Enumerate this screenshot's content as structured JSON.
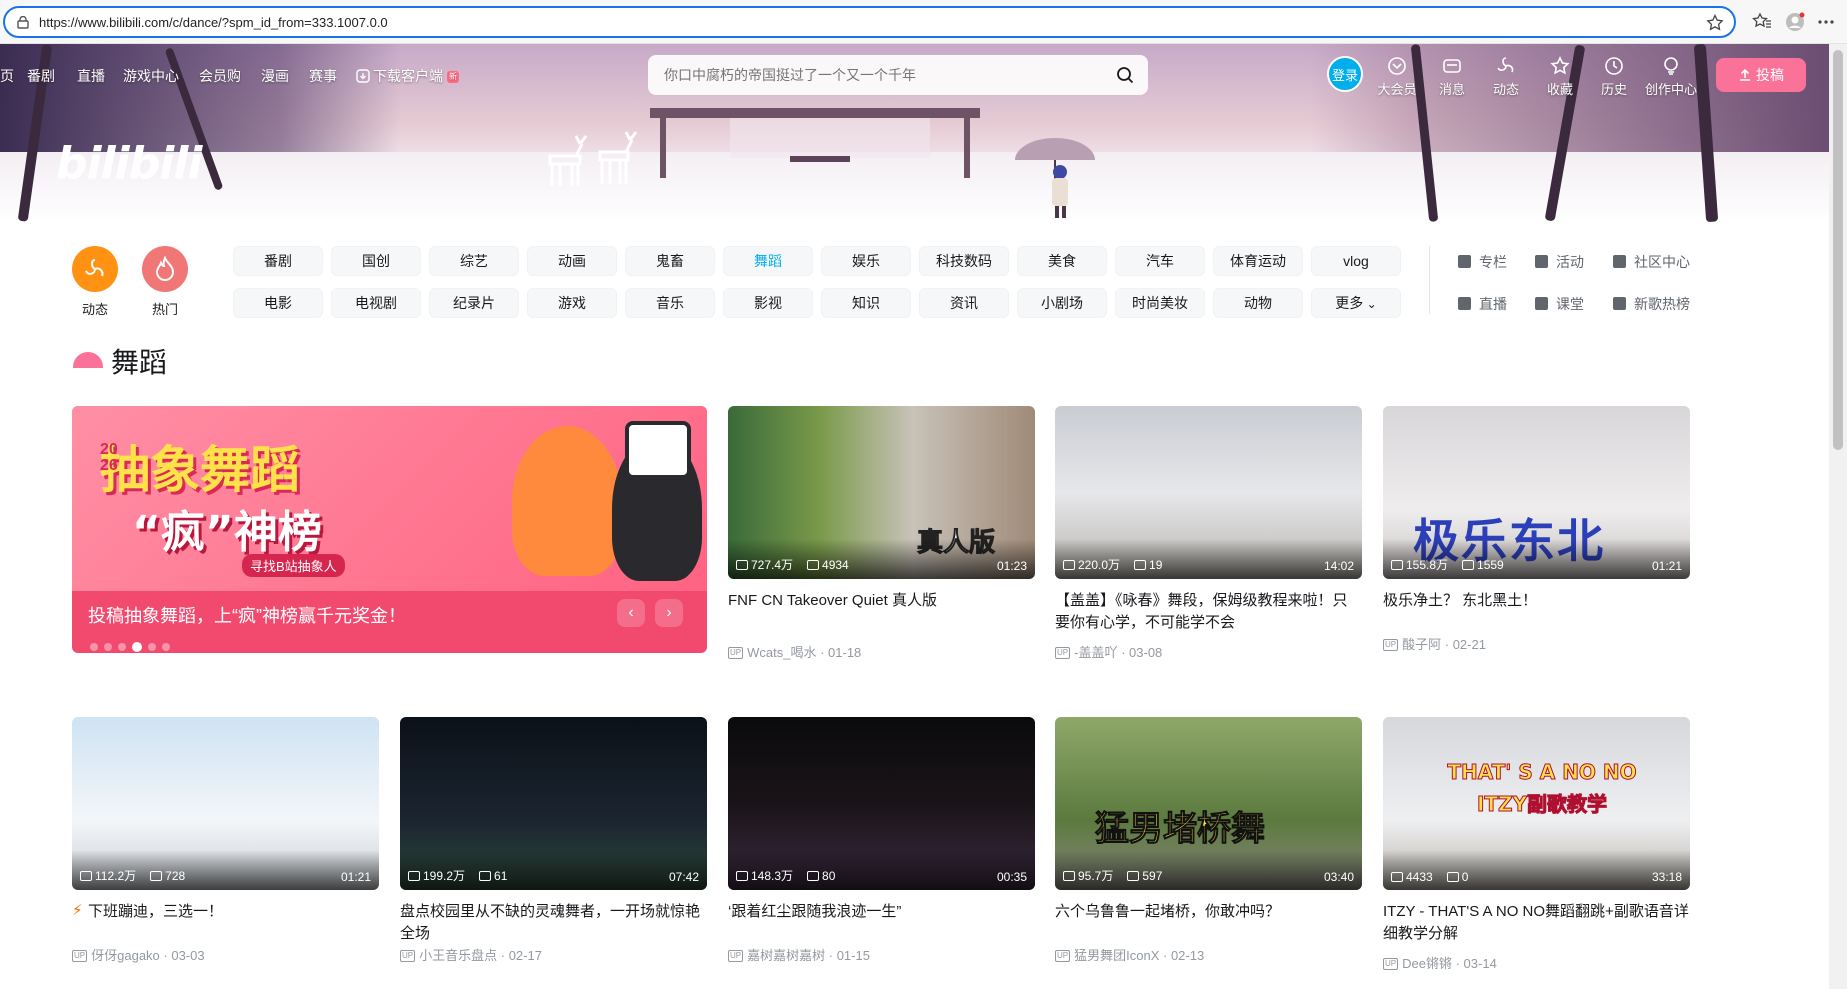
{
  "browser": {
    "url": "https://www.bilibili.com/c/dance/?spm_id_from=333.1007.0.0"
  },
  "header": {
    "logo_text": "bilibili",
    "nav_items": [
      "页",
      "番剧",
      "直播",
      "游戏中心",
      "会员购",
      "漫画",
      "赛事",
      "下载客户端"
    ],
    "download_badge": "新",
    "search_placeholder": "你口中腐朽的帝国挺过了一个又一个千年",
    "login_label": "登录",
    "right_nav": [
      "大会员",
      "消息",
      "动态",
      "收藏",
      "历史",
      "创作中心"
    ],
    "upload_label": "投稿"
  },
  "channels": {
    "quick": [
      {
        "label": "动态",
        "icon": "dynamic-icon",
        "color": "#ff9212"
      },
      {
        "label": "热门",
        "icon": "hot-icon",
        "color": "#f07775"
      }
    ],
    "row1": [
      "番剧",
      "国创",
      "综艺",
      "动画",
      "鬼畜",
      "舞蹈",
      "娱乐",
      "科技数码",
      "美食",
      "汽车",
      "体育运动",
      "vlog"
    ],
    "row2": [
      "电影",
      "电视剧",
      "纪录片",
      "游戏",
      "音乐",
      "影视",
      "知识",
      "资讯",
      "小剧场",
      "时尚美妆",
      "动物",
      "更多"
    ],
    "active": "舞蹈",
    "side_links": [
      "专栏",
      "活动",
      "社区中心",
      "直播",
      "课堂",
      "新歌热榜"
    ]
  },
  "section": {
    "title": "舞蹈",
    "accent_color": "#fb7299"
  },
  "carousel": {
    "art_line1": "抽象舞蹈",
    "art_year": "2026",
    "art_line2": "“疯”神榜",
    "art_sub": "寻找B站抽象人",
    "caption": "投稿抽象舞蹈，上“疯”神榜赢千元奖金！",
    "prev": "‹",
    "next": "›",
    "dot_count": 6,
    "active_dot": 3
  },
  "videos": [
    {
      "views": "727.4万",
      "comments": "4934",
      "duration": "01:23",
      "title": "FNF CN Takeover Quiet 真人版",
      "author": "Wcats_喝水",
      "date": "01-18",
      "overlay": "真人版"
    },
    {
      "views": "220.0万",
      "comments": "19",
      "duration": "14:02",
      "title": "【盖盖】《咏春》舞段，保姆级教程来啦！只要你有心学，不可能学不会",
      "author": "-盖盖吖",
      "date": "03-08",
      "overlay": ""
    },
    {
      "views": "155.8万",
      "comments": "1559",
      "duration": "01:21",
      "title": "极乐净土？ 东北黑土！",
      "author": "酸子阿",
      "date": "02-21",
      "overlay": "极乐东北"
    },
    {
      "views": "112.2万",
      "comments": "728",
      "duration": "01:21",
      "title": "下班蹦迪，三选一！",
      "author": "伢伢gagako",
      "date": "03-03",
      "overlay": ""
    },
    {
      "views": "199.2万",
      "comments": "61",
      "duration": "07:42",
      "title": "盘点校园里从不缺的灵魂舞者，一开场就惊艳全场",
      "author": "小王音乐盘点",
      "date": "02-17",
      "overlay": ""
    },
    {
      "views": "148.3万",
      "comments": "80",
      "duration": "00:35",
      "title": "‘跟着红尘跟随我浪迹一生”",
      "author": "嘉树嘉树嘉树",
      "date": "01-15",
      "overlay": ""
    },
    {
      "views": "95.7万",
      "comments": "597",
      "duration": "03:40",
      "title": "六个乌鲁鲁一起堵桥，你敢冲吗？",
      "author": "猛男舞团IconX",
      "date": "02-13",
      "overlay": "猛男堵桥舞"
    },
    {
      "views": "4433",
      "comments": "0",
      "duration": "33:18",
      "title": "ITZY - THAT'S A NO NO舞蹈翻跳+副歌语音详细教学分解",
      "author": "Dee锵锵",
      "date": "03-14",
      "overlay": "THAT' S A NO NO ITZY副歌教学"
    }
  ],
  "colors": {
    "accent_blue": "#00aeec",
    "accent_pink": "#fb7299",
    "text_secondary": "#9499a0"
  }
}
